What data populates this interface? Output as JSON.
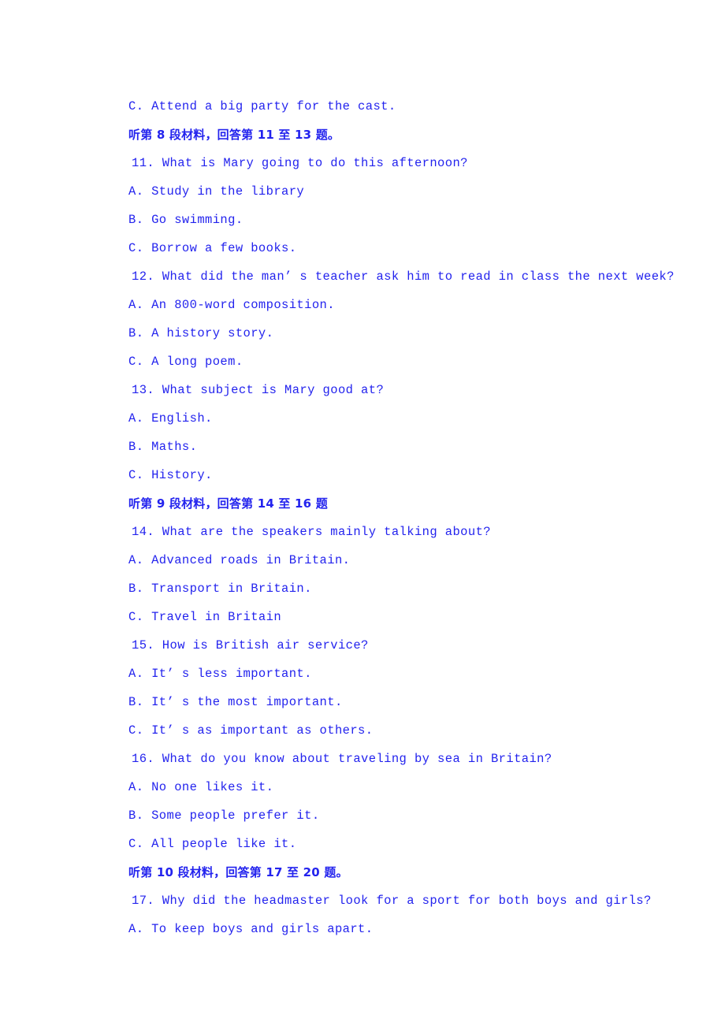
{
  "document": {
    "text_color": "#2323ee",
    "background_color": "#ffffff"
  },
  "lines": [
    {
      "kind": "option",
      "text": "C. Attend a big party for the cast."
    },
    {
      "kind": "section-header",
      "text": "听第 8 段材料，回答第 11 至 13 题。"
    },
    {
      "kind": "question",
      "text": "11. What is Mary going to do this afternoon?"
    },
    {
      "kind": "option",
      "text": "A. Study in the library"
    },
    {
      "kind": "option",
      "text": "B. Go swimming."
    },
    {
      "kind": "option",
      "text": "C. Borrow a few books."
    },
    {
      "kind": "question",
      "text": "12. What did the man’ s teacher ask him to read in class the next week?"
    },
    {
      "kind": "option",
      "text": "A. An 800-word composition."
    },
    {
      "kind": "option",
      "text": "B. A history story."
    },
    {
      "kind": "option",
      "text": "C. A long poem."
    },
    {
      "kind": "question",
      "text": "13. What subject is Mary good at?"
    },
    {
      "kind": "option",
      "text": "A. English."
    },
    {
      "kind": "option",
      "text": "B. Maths."
    },
    {
      "kind": "option",
      "text": "C. History."
    },
    {
      "kind": "section-header",
      "text": "听第 9 段材料，回答第 14 至 16 题"
    },
    {
      "kind": "question",
      "text": "14. What are the speakers mainly talking about?"
    },
    {
      "kind": "option",
      "text": "A. Advanced roads in Britain."
    },
    {
      "kind": "option",
      "text": "B. Transport in Britain."
    },
    {
      "kind": "option",
      "text": "C. Travel in Britain"
    },
    {
      "kind": "question",
      "text": "15. How is British air service?"
    },
    {
      "kind": "option",
      "text": "A. It’ s less important."
    },
    {
      "kind": "option",
      "text": "B. It’ s the most important."
    },
    {
      "kind": "option",
      "text": "C. It’ s as important as others."
    },
    {
      "kind": "question",
      "text": "16. What do you know about traveling by sea in Britain?"
    },
    {
      "kind": "option",
      "text": "A. No one likes it."
    },
    {
      "kind": "option",
      "text": "B. Some people prefer it."
    },
    {
      "kind": "option",
      "text": "C. All people like it."
    },
    {
      "kind": "section-header",
      "text": "听第 10 段材料，回答第 17 至 20 题。"
    },
    {
      "kind": "question",
      "text": "17. Why did the headmaster look for a sport for both boys and girls?"
    },
    {
      "kind": "option",
      "text": "A. To keep boys and girls apart."
    }
  ]
}
